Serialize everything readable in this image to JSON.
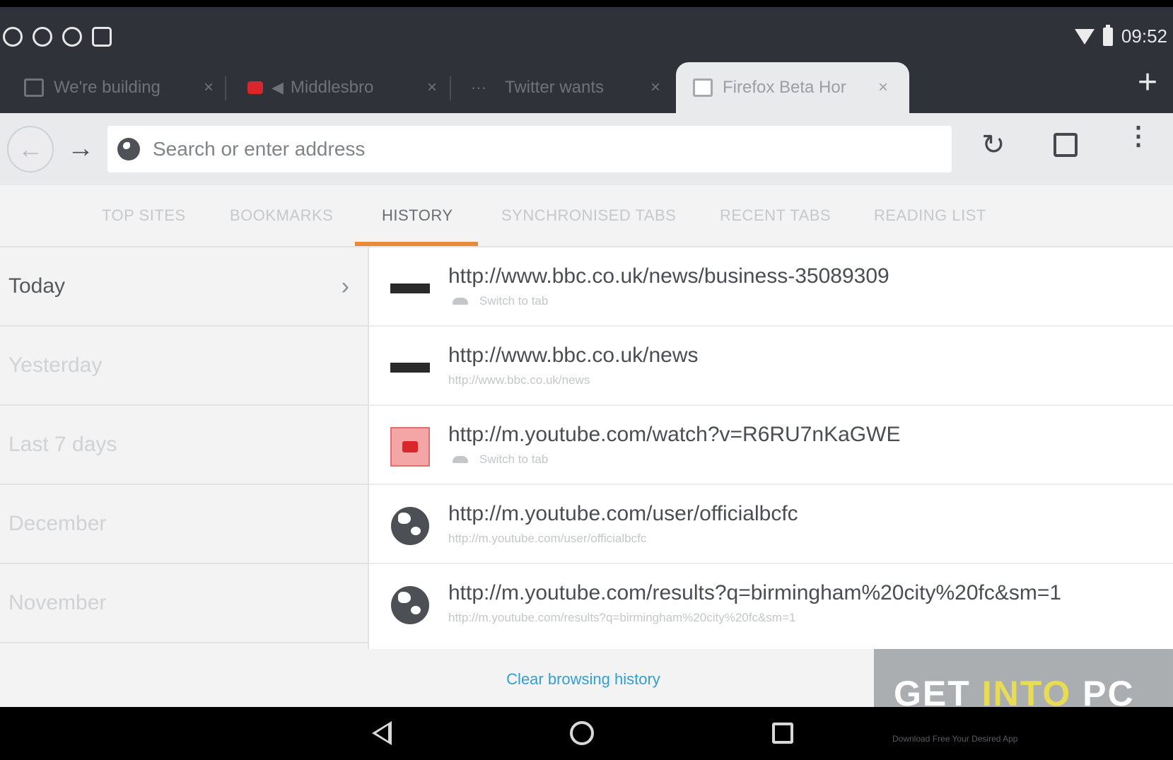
{
  "status": {
    "time": "09:52"
  },
  "tabs": [
    {
      "label": "We're building",
      "close": "×"
    },
    {
      "label": "Middlesbro",
      "close": "×"
    },
    {
      "label": "Twitter wants",
      "close": "×"
    },
    {
      "label": "Firefox Beta Hor",
      "close": "×",
      "active": true
    }
  ],
  "toolbar": {
    "search_placeholder": "Search or enter address",
    "new_tab": "+"
  },
  "panel_tabs": [
    "TOP SITES",
    "BOOKMARKS",
    "HISTORY",
    "SYNCHRONISED TABS",
    "RECENT TABS",
    "READING LIST"
  ],
  "active_panel": "HISTORY",
  "time_ranges": [
    "Today",
    "Yesterday",
    "Last 7 days",
    "December",
    "November"
  ],
  "history": [
    {
      "title": "http://www.bbc.co.uk/news/business-35089309",
      "sub": "Switch to tab",
      "icon": "bbc-icon"
    },
    {
      "title": "http://www.bbc.co.uk/news",
      "sub": "http://www.bbc.co.uk/news",
      "icon": "bbc-icon"
    },
    {
      "title": "http://m.youtube.com/watch?v=R6RU7nKaGWE",
      "sub": "Switch to tab",
      "icon": "youtube-icon"
    },
    {
      "title": "http://m.youtube.com/user/officialbcfc",
      "sub": "http://m.youtube.com/user/officialbcfc",
      "icon": "globe-icon"
    },
    {
      "title": "http://m.youtube.com/results?q=birmingham%20city%20fc&sm=1",
      "sub": "http://m.youtube.com/results?q=birmingham%20city%20fc&sm=1",
      "icon": "globe-icon"
    }
  ],
  "footer": {
    "clear_history": "Clear browsing history"
  },
  "watermark": {
    "text_a": "GET ",
    "text_b": "INTO",
    "text_c": " PC",
    "tagline": "Download Free Your Desired App"
  },
  "colors": {
    "accent": "#e98a36",
    "link": "#2f9fd6"
  }
}
